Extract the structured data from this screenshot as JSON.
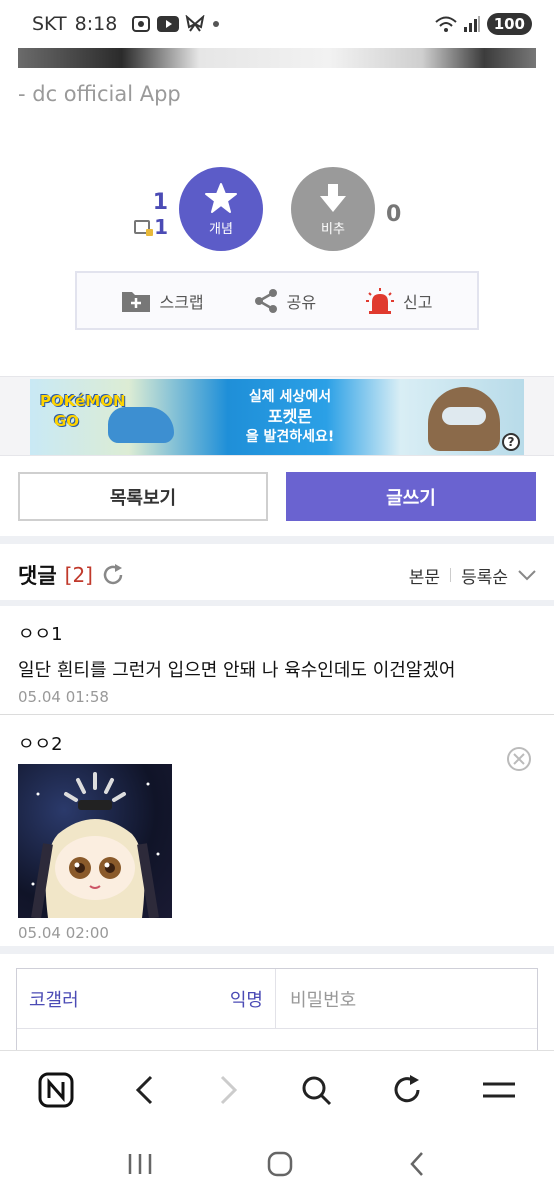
{
  "status_bar": {
    "carrier": "SKT",
    "time": "8:18",
    "battery": "100"
  },
  "post": {
    "signature": "- dc official App"
  },
  "recommend": {
    "up_count": "1",
    "fixed_up_count": "1",
    "up_label": "개념",
    "down_label": "비추",
    "down_count": "0"
  },
  "actions": {
    "scrap": "스크랩",
    "share": "공유",
    "report": "신고"
  },
  "ad": {
    "logo_line1": "POKéMON",
    "logo_line2": "GO",
    "line1": "실제 세상에서",
    "line2": "포켓몬",
    "line3": "을 발견하세요!",
    "help": "?"
  },
  "buttons": {
    "list": "목록보기",
    "write": "글쓰기"
  },
  "comments": {
    "title": "댓글",
    "count": "[2]",
    "sort_main": "본문",
    "sort_order": "등록순",
    "items": [
      {
        "author": "ㅇㅇ1",
        "body": "일단 흰티를 그런거 입으면 안돼 나 육수인데도 이건알겠어",
        "date": "05.04 01:58"
      },
      {
        "author": "ㅇㅇ2",
        "date": "05.04 02:00"
      }
    ]
  },
  "form": {
    "nickname": "코갤러",
    "anonymous": "익명",
    "password_placeholder": "비밀번호"
  },
  "colors": {
    "accent": "#5c5cc8",
    "write_button": "#6a63d0",
    "count_red": "#c0392b",
    "report_red": "#e03a2f"
  }
}
